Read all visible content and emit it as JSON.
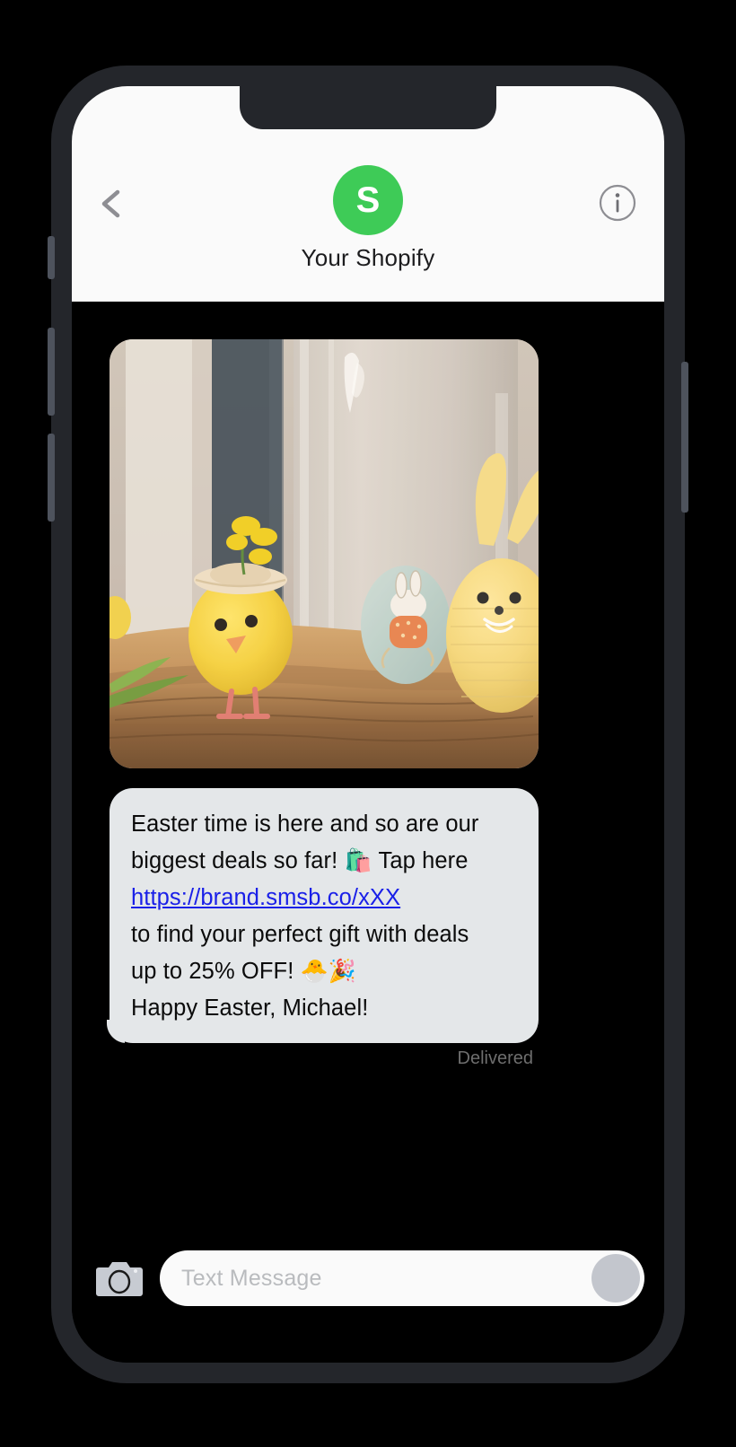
{
  "device": {
    "frame_color": "#24262B",
    "screen_bg": "#000000",
    "button_color": "#4E535D",
    "hardware_buttons": [
      "mute-switch",
      "volume-up-button",
      "volume-down-button",
      "power-button"
    ]
  },
  "header": {
    "back_icon": "chevron-left-icon",
    "avatar_letter": "S",
    "avatar_color": "#3ECB57",
    "contact_name": "Your Shopify",
    "info_icon": "info-circle-icon",
    "background": "#FAFAFA"
  },
  "conversation": {
    "attachment": {
      "icon": "mms-photo",
      "alt": "Easter decorations: yellow chick with flower hat, painted bunny egg and knitted bunny on a wood slice"
    },
    "message": {
      "line1": "Easter time is here and so are our",
      "line2_pre": "biggest deals so far! ",
      "line2_emoji": "🛍️",
      "line2_post": " Tap here",
      "link": "https://brand.smsb.co/xXX",
      "line4": "to find your perfect gift with deals",
      "line5_pre": "up to 25% OFF! ",
      "line5_emoji": "🐣🎉",
      "line6": "Happy Easter, Michael!",
      "bubble_color": "#E4E7E9",
      "link_color": "#1A20E8"
    },
    "status": "Delivered"
  },
  "input_bar": {
    "camera_icon": "camera-icon",
    "placeholder": "Text Message",
    "value": "",
    "send_icon": "send-button"
  }
}
